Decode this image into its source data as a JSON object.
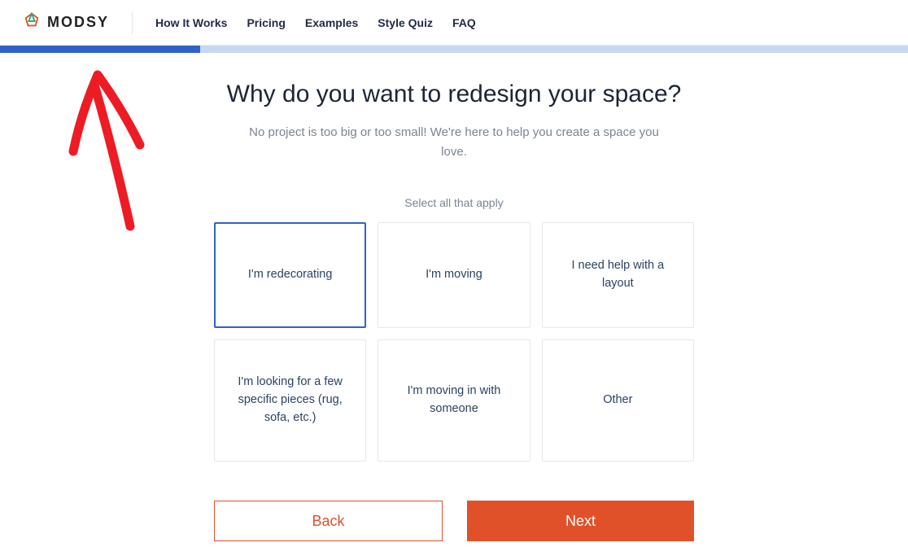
{
  "brand": "MODSY",
  "nav": {
    "how": "How It Works",
    "pricing": "Pricing",
    "examples": "Examples",
    "quiz": "Style Quiz",
    "faq": "FAQ"
  },
  "progress_percent": 22,
  "title": "Why do you want to redesign your space?",
  "subtitle": "No project is too big or too small! We're here to help you create a space you love.",
  "select_hint": "Select all that apply",
  "options": [
    {
      "label": "I'm redecorating",
      "selected": true
    },
    {
      "label": "I'm moving",
      "selected": false
    },
    {
      "label": "I need help with a layout",
      "selected": false
    },
    {
      "label": "I'm looking for a few specific pieces (rug, sofa, etc.)",
      "selected": false
    },
    {
      "label": "I'm moving in with someone",
      "selected": false
    },
    {
      "label": "Other",
      "selected": false
    }
  ],
  "buttons": {
    "back": "Back",
    "next": "Next"
  },
  "colors": {
    "progress_bg": "#c7d6f1",
    "progress_fill": "#2f62c9",
    "accent": "#e0512a",
    "annotation": "#ed1c24"
  }
}
